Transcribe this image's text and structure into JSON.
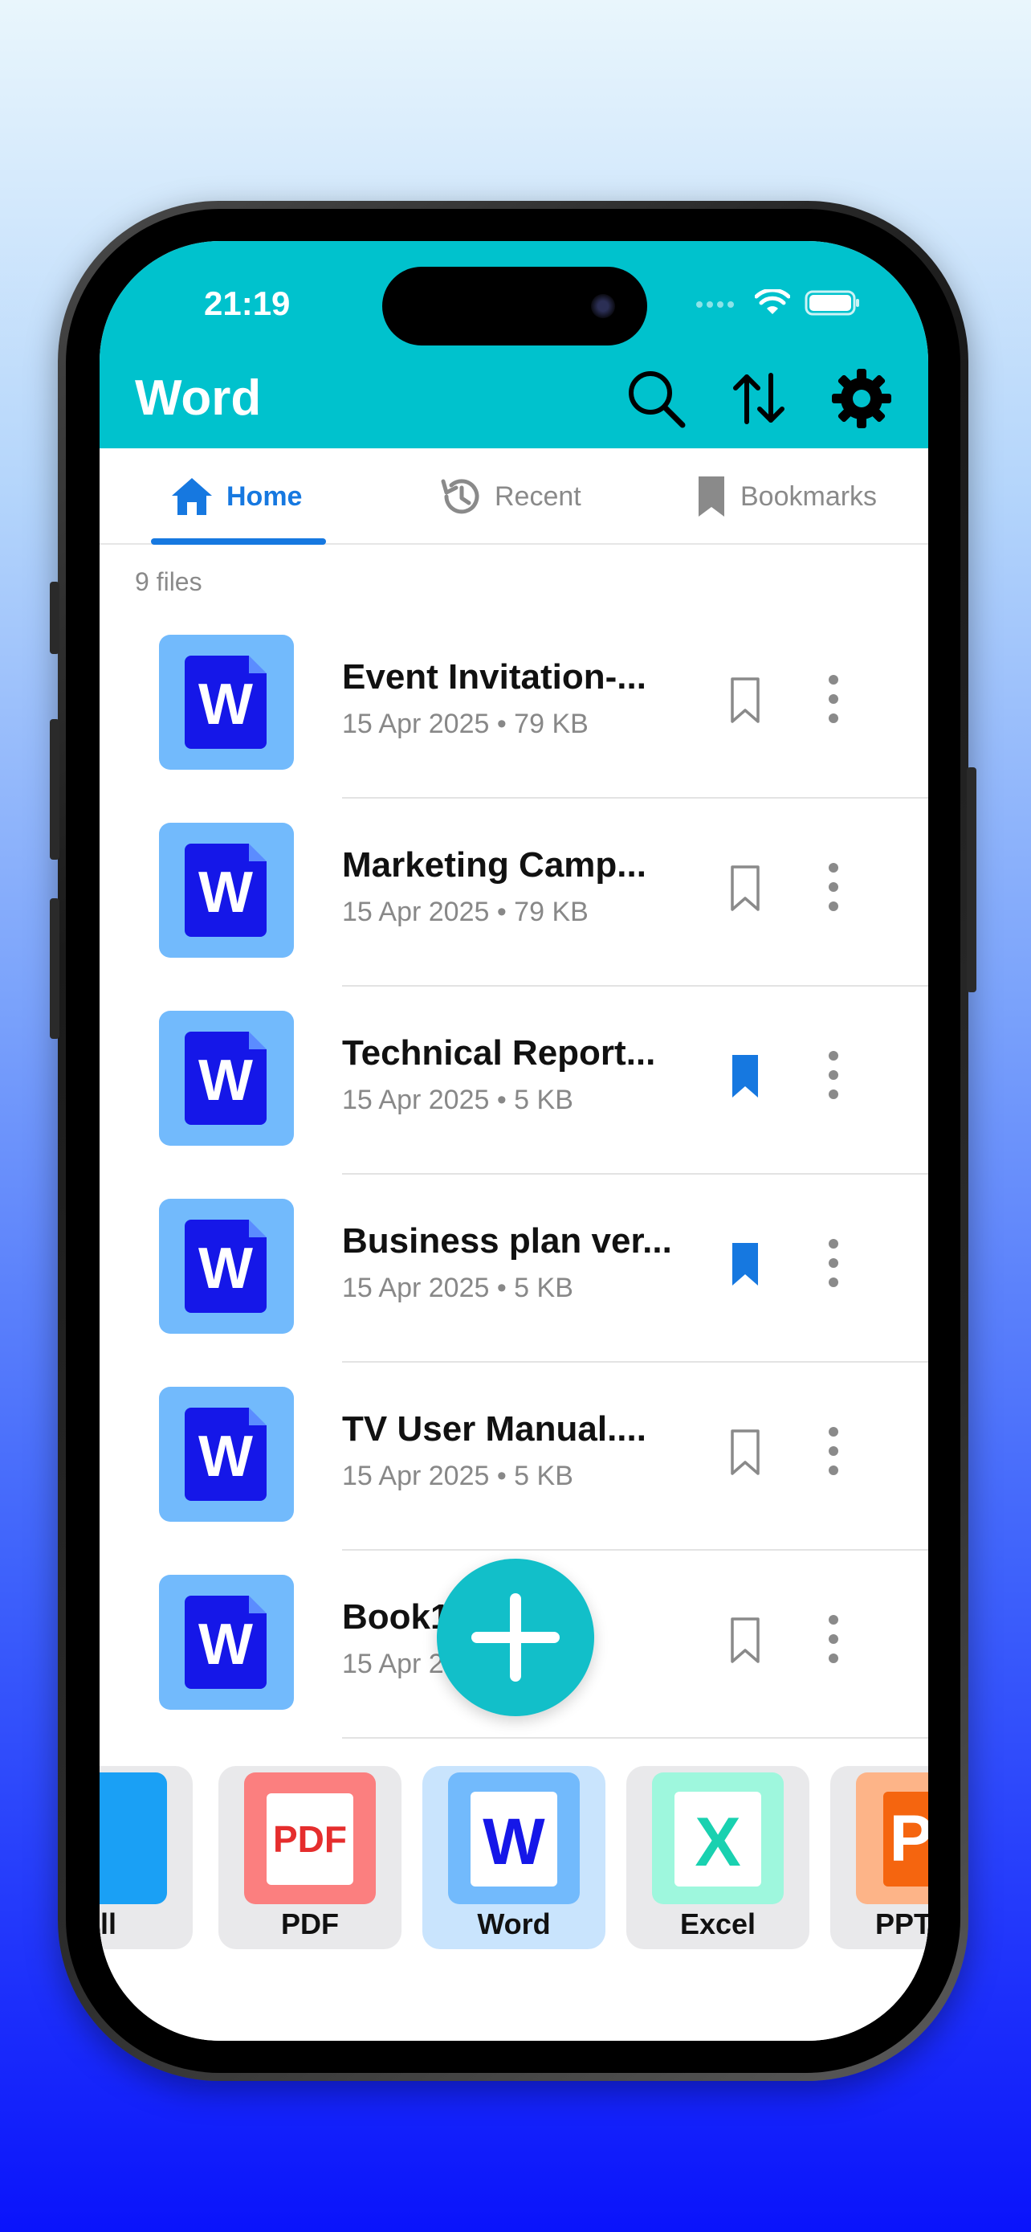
{
  "status": {
    "time": "21:19"
  },
  "header": {
    "title": "Word"
  },
  "colors": {
    "header": "#00c2cd",
    "accent": "#1678e0",
    "fab": "#12bfc9",
    "doc_blue": "#1517e8",
    "bookmark_active": "#1678e0"
  },
  "tabs": [
    {
      "label": "Home",
      "icon": "home-icon",
      "active": true
    },
    {
      "label": "Recent",
      "icon": "history-icon",
      "active": false
    },
    {
      "label": "Bookmarks",
      "icon": "bookmark-icon",
      "active": false
    }
  ],
  "files_count": "9 files",
  "files": [
    {
      "name": "Event Invitation-...",
      "meta": "15 Apr 2025 • 79 KB",
      "bookmarked": false
    },
    {
      "name": "Marketing Camp...",
      "meta": "15 Apr 2025 • 79 KB",
      "bookmarked": false
    },
    {
      "name": "Technical Report...",
      "meta": "15 Apr 2025 • 5 KB",
      "bookmarked": true
    },
    {
      "name": "Business plan ver...",
      "meta": "15 Apr 2025 • 5 KB",
      "bookmarked": true
    },
    {
      "name": "TV User Manual....",
      "meta": "15 Apr 2025 • 5 KB",
      "bookmarked": false
    },
    {
      "name": "Book1.docx",
      "meta": "15 Apr 2025 • 5 KB",
      "bookmarked": false
    }
  ],
  "doc_letter": "W",
  "categories": [
    {
      "label": "All",
      "icon": "all-files-icon",
      "active": false
    },
    {
      "label": "PDF",
      "icon": "pdf-icon",
      "active": false,
      "icon_text": "PDF"
    },
    {
      "label": "Word",
      "icon": "word-icon",
      "active": true,
      "icon_text": "W"
    },
    {
      "label": "Excel",
      "icon": "excel-icon",
      "active": false,
      "icon_text": "X"
    },
    {
      "label": "PPT",
      "icon": "ppt-icon",
      "active": false,
      "icon_text": "P"
    }
  ]
}
